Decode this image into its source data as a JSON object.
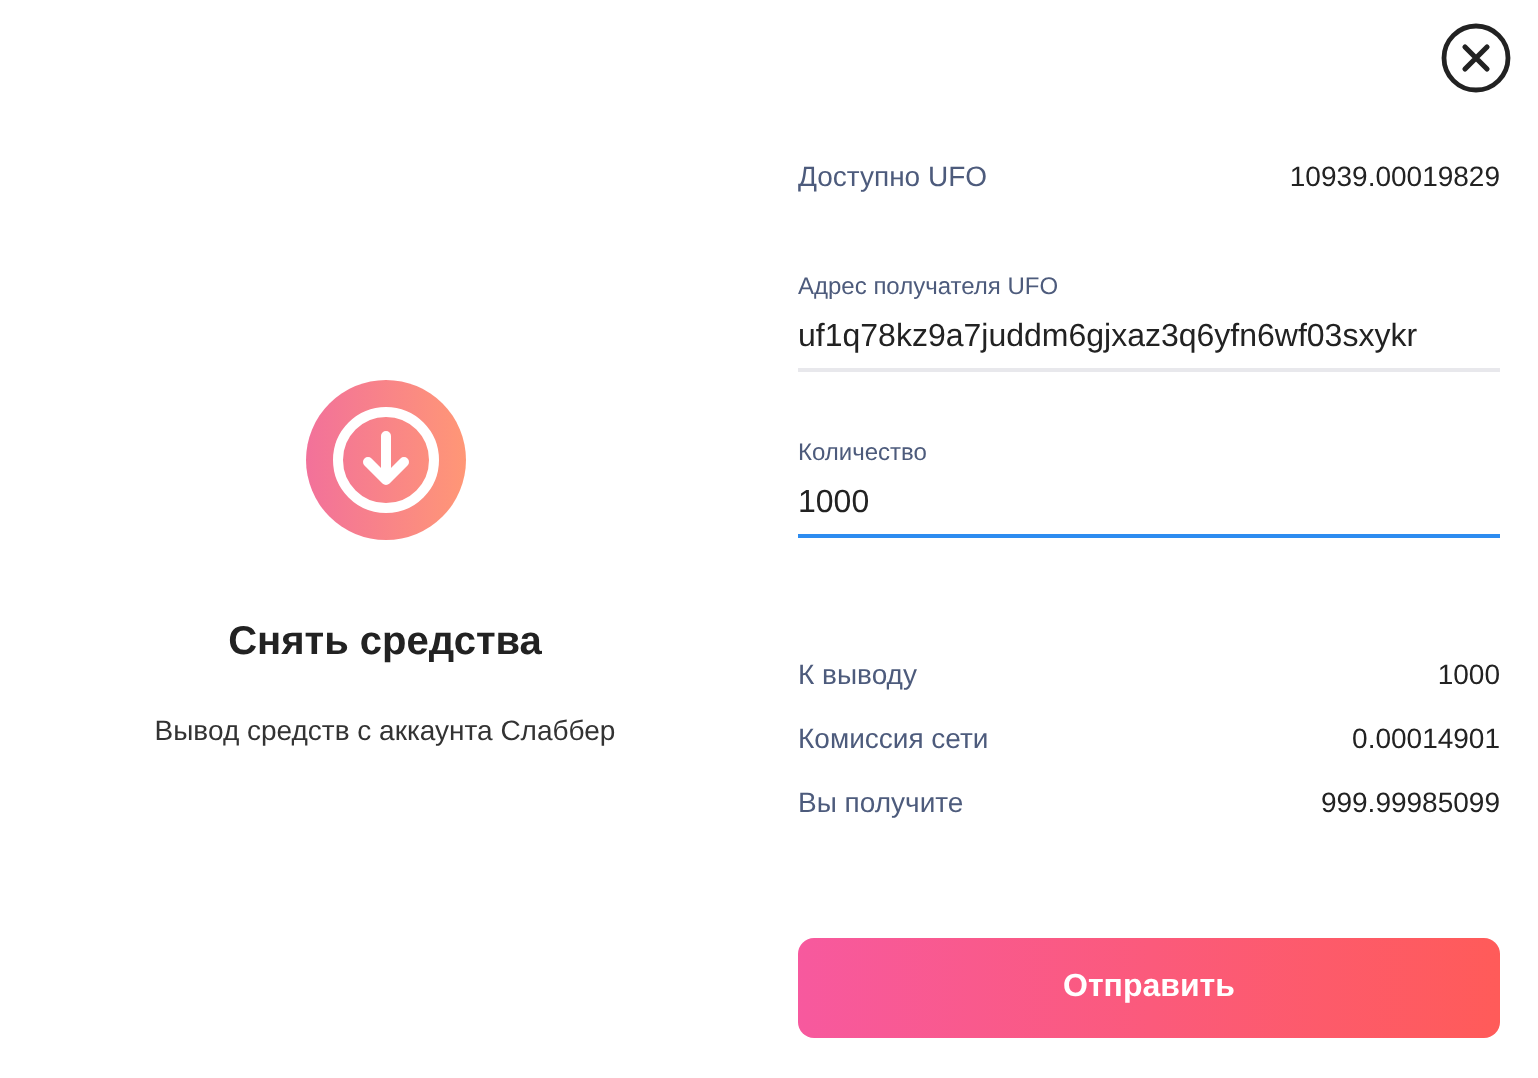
{
  "intro": {
    "title": "Снять средства",
    "subtitle": "Вывод средств с аккаунта Слаббер"
  },
  "balance": {
    "label": "Доступно UFO",
    "value": "10939.00019829"
  },
  "fields": [
    {
      "label": "Адрес получателя UFO",
      "value": "uf1q78kz9a7juddm6gjxaz3q6yfn6wf03sxykr",
      "focused": false
    },
    {
      "label": "Количество",
      "value": "1000",
      "focused": true
    }
  ],
  "summary": [
    {
      "label": "К выводу",
      "value": "1000"
    },
    {
      "label": "Комиссия сети",
      "value": "0.00014901"
    },
    {
      "label": "Вы получите",
      "value": "999.99985099"
    }
  ],
  "submit": {
    "label": "Отправить"
  }
}
